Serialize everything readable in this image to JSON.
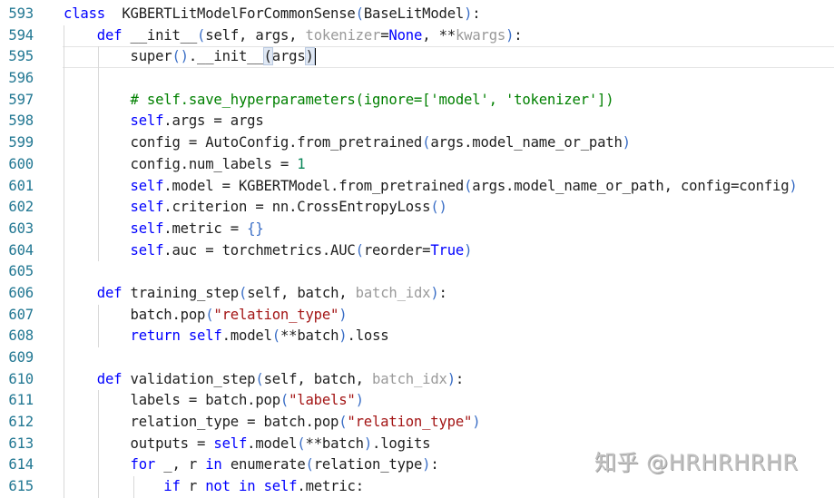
{
  "editor": {
    "current_line": 595,
    "lines": [
      {
        "number": "593",
        "tokens": [
          [
            "kw",
            "class"
          ],
          [
            "",
            "  "
          ],
          [
            "fn",
            "KGBERTLitModelForCommonSense"
          ],
          [
            "par",
            "("
          ],
          [
            "",
            "BaseLitModel"
          ],
          [
            "par",
            ")"
          ],
          [
            "",
            ":"
          ]
        ]
      },
      {
        "number": "594",
        "tokens": [
          [
            "",
            "    "
          ],
          [
            "kw",
            "def"
          ],
          [
            "",
            " __init__"
          ],
          [
            "par",
            "("
          ],
          [
            "",
            "self, args, "
          ],
          [
            "dim",
            "tokenizer"
          ],
          [
            "",
            "="
          ],
          [
            "const",
            "None"
          ],
          [
            "",
            ", **"
          ],
          [
            "dim",
            "kwargs"
          ],
          [
            "par",
            ")"
          ],
          [
            "",
            ":"
          ]
        ]
      },
      {
        "number": "595",
        "tokens": [
          [
            "",
            "        super"
          ],
          [
            "par",
            "()"
          ],
          [
            "",
            ".__init__"
          ],
          [
            "bm",
            "("
          ],
          [
            "",
            "args"
          ],
          [
            "bm",
            ")"
          ]
        ]
      },
      {
        "number": "596",
        "tokens": []
      },
      {
        "number": "597",
        "tokens": [
          [
            "",
            "        "
          ],
          [
            "cmt",
            "# self.save_hyperparameters(ignore=['model', 'tokenizer'])"
          ]
        ]
      },
      {
        "number": "598",
        "tokens": [
          [
            "",
            "        "
          ],
          [
            "slf",
            "self"
          ],
          [
            "",
            ".args = args"
          ]
        ]
      },
      {
        "number": "599",
        "tokens": [
          [
            "",
            "        config = AutoConfig.from_pretrained"
          ],
          [
            "par",
            "("
          ],
          [
            "",
            "args.model_name_or_path"
          ],
          [
            "par",
            ")"
          ]
        ]
      },
      {
        "number": "600",
        "tokens": [
          [
            "",
            "        config.num_labels = "
          ],
          [
            "num",
            "1"
          ]
        ]
      },
      {
        "number": "601",
        "tokens": [
          [
            "",
            "        "
          ],
          [
            "slf",
            "self"
          ],
          [
            "",
            ".model = KGBERTModel.from_pretrained"
          ],
          [
            "par",
            "("
          ],
          [
            "",
            "args.model_name_or_path, config=config"
          ],
          [
            "par",
            ")"
          ]
        ]
      },
      {
        "number": "602",
        "tokens": [
          [
            "",
            "        "
          ],
          [
            "slf",
            "self"
          ],
          [
            "",
            ".criterion = nn.CrossEntropyLoss"
          ],
          [
            "par",
            "()"
          ]
        ]
      },
      {
        "number": "603",
        "tokens": [
          [
            "",
            "        "
          ],
          [
            "slf",
            "self"
          ],
          [
            "",
            ".metric = "
          ],
          [
            "par",
            "{}"
          ]
        ]
      },
      {
        "number": "604",
        "tokens": [
          [
            "",
            "        "
          ],
          [
            "slf",
            "self"
          ],
          [
            "",
            ".auc = torchmetrics.AUC"
          ],
          [
            "par",
            "("
          ],
          [
            "",
            "reorder="
          ],
          [
            "const",
            "True"
          ],
          [
            "par",
            ")"
          ]
        ]
      },
      {
        "number": "605",
        "tokens": []
      },
      {
        "number": "606",
        "tokens": [
          [
            "",
            "    "
          ],
          [
            "kw",
            "def"
          ],
          [
            "",
            " training_step"
          ],
          [
            "par",
            "("
          ],
          [
            "",
            "self, batch, "
          ],
          [
            "dim",
            "batch_idx"
          ],
          [
            "par",
            ")"
          ],
          [
            "",
            ":"
          ]
        ]
      },
      {
        "number": "607",
        "tokens": [
          [
            "",
            "        batch.pop"
          ],
          [
            "par",
            "("
          ],
          [
            "str",
            "\"relation_type\""
          ],
          [
            "par",
            ")"
          ]
        ]
      },
      {
        "number": "608",
        "tokens": [
          [
            "",
            "        "
          ],
          [
            "kw",
            "return"
          ],
          [
            "",
            " "
          ],
          [
            "slf",
            "self"
          ],
          [
            "",
            ".model"
          ],
          [
            "par",
            "("
          ],
          [
            "",
            "**batch"
          ],
          [
            "par",
            ")"
          ],
          [
            "",
            ".loss"
          ]
        ]
      },
      {
        "number": "609",
        "tokens": []
      },
      {
        "number": "610",
        "tokens": [
          [
            "",
            "    "
          ],
          [
            "kw",
            "def"
          ],
          [
            "",
            " validation_step"
          ],
          [
            "par",
            "("
          ],
          [
            "",
            "self, batch, "
          ],
          [
            "dim",
            "batch_idx"
          ],
          [
            "par",
            ")"
          ],
          [
            "",
            ":"
          ]
        ]
      },
      {
        "number": "611",
        "tokens": [
          [
            "",
            "        labels = batch.pop"
          ],
          [
            "par",
            "("
          ],
          [
            "str",
            "\"labels\""
          ],
          [
            "par",
            ")"
          ]
        ]
      },
      {
        "number": "612",
        "tokens": [
          [
            "",
            "        relation_type = batch.pop"
          ],
          [
            "par",
            "("
          ],
          [
            "str",
            "\"relation_type\""
          ],
          [
            "par",
            ")"
          ]
        ]
      },
      {
        "number": "613",
        "tokens": [
          [
            "",
            "        outputs = "
          ],
          [
            "slf",
            "self"
          ],
          [
            "",
            ".model"
          ],
          [
            "par",
            "("
          ],
          [
            "",
            "**batch"
          ],
          [
            "par",
            ")"
          ],
          [
            "",
            ".logits"
          ]
        ]
      },
      {
        "number": "614",
        "tokens": [
          [
            "",
            "        "
          ],
          [
            "kw",
            "for"
          ],
          [
            "",
            " _, r "
          ],
          [
            "kw",
            "in"
          ],
          [
            "",
            " enumerate"
          ],
          [
            "par",
            "("
          ],
          [
            "",
            "relation_type"
          ],
          [
            "par",
            ")"
          ],
          [
            "",
            ":"
          ]
        ]
      },
      {
        "number": "615",
        "tokens": [
          [
            "",
            "            "
          ],
          [
            "kw",
            "if"
          ],
          [
            "",
            " r "
          ],
          [
            "kw",
            "not"
          ],
          [
            "",
            " "
          ],
          [
            "kw",
            "in"
          ],
          [
            "",
            " "
          ],
          [
            "slf",
            "self"
          ],
          [
            "",
            ".metric:"
          ]
        ]
      }
    ]
  },
  "watermark": {
    "text": "知乎 @HRHRHRHR"
  }
}
